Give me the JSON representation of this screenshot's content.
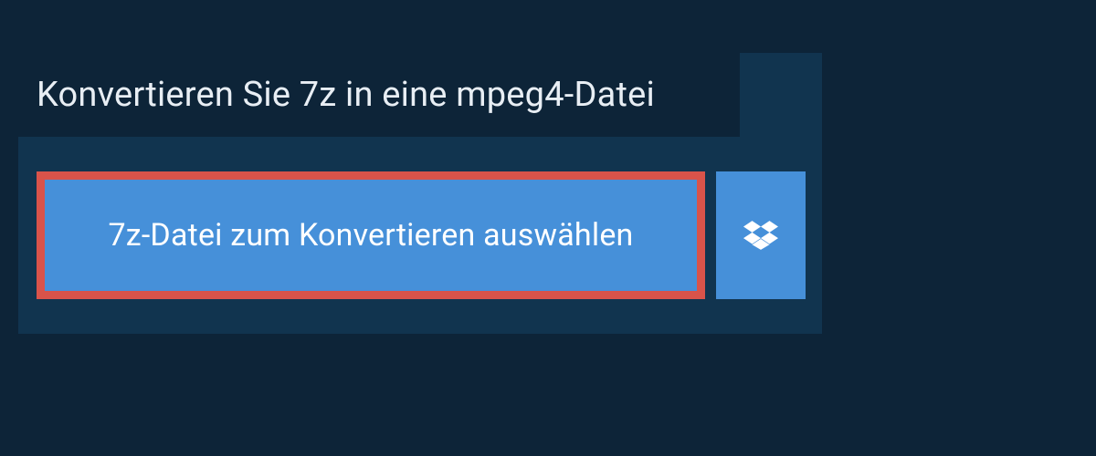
{
  "header": {
    "title": "Konvertieren Sie 7z in eine mpeg4-Datei"
  },
  "actions": {
    "select_file_label": "7z-Datei zum Konvertieren auswählen"
  },
  "colors": {
    "background": "#0d2438",
    "panel": "#11344f",
    "button": "#4690d9",
    "highlight_border": "#d9534a"
  }
}
